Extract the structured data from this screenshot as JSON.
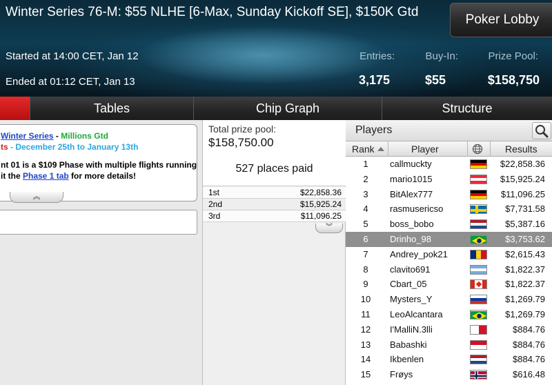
{
  "header": {
    "title": "Winter Series 76-M: $55 NLHE [6-Max, Sunday Kickoff SE], $150K Gtd",
    "lobby_button": "Poker Lobby",
    "started": "Started at 14:00 CET, Jan 12",
    "ended": "Ended at 01:12 CET, Jan 13",
    "entries_label": "Entries:",
    "entries_value": "3,175",
    "buyin_label": "Buy-In:",
    "buyin_value": "$55",
    "prize_label": "Prize Pool:",
    "prize_value": "$158,750"
  },
  "tabs": [
    {
      "label": ""
    },
    {
      "label": "Tables"
    },
    {
      "label": "Chip Graph"
    },
    {
      "label": "Structure"
    }
  ],
  "promo": {
    "series_link": "Winter Series",
    "separator": " - ",
    "millions": "Millions Gtd",
    "prefix_red": "ts",
    "dates": " - December 25th to January 13th",
    "line3": "nt 01 is a $109 Phase with multiple flights running",
    "line4_pre": "it the ",
    "phase_link": "Phase 1 tab",
    "line4_post": " for more details!",
    "tab_glyph": "︽"
  },
  "prize_pool": {
    "label": "Total prize pool:",
    "value": "$158,750.00",
    "places": "527 places paid",
    "payouts": [
      {
        "place": "1st",
        "amount": "$22,858.36"
      },
      {
        "place": "2nd",
        "amount": "$15,925.24"
      },
      {
        "place": "3rd",
        "amount": "$11,096.25"
      }
    ],
    "tab_glyph": "︾"
  },
  "players": {
    "title": "Players",
    "col_rank": "Rank",
    "col_player": "Player",
    "col_results": "Results",
    "rows": [
      {
        "rank": "1",
        "name": "callmuckty",
        "flag": "de",
        "result": "$22,858.36"
      },
      {
        "rank": "2",
        "name": "mario1015",
        "flag": "at",
        "result": "$15,925.24"
      },
      {
        "rank": "3",
        "name": "BitAlex777",
        "flag": "de",
        "result": "$11,096.25"
      },
      {
        "rank": "4",
        "name": "rasmusericso",
        "flag": "se",
        "result": "$7,731.58"
      },
      {
        "rank": "5",
        "name": "boss_bobo",
        "flag": "nl",
        "result": "$5,387.16"
      },
      {
        "rank": "6",
        "name": "Drinho_98",
        "flag": "br",
        "result": "$3,753.62"
      },
      {
        "rank": "7",
        "name": "Andrey_pok21",
        "flag": "ro",
        "result": "$2,615.43"
      },
      {
        "rank": "8",
        "name": "clavito691",
        "flag": "ar",
        "result": "$1,822.37"
      },
      {
        "rank": "9",
        "name": "Cbart_05",
        "flag": "ca",
        "result": "$1,822.37"
      },
      {
        "rank": "10",
        "name": "Mysters_Y",
        "flag": "ru",
        "result": "$1,269.79"
      },
      {
        "rank": "11",
        "name": "LeoAlcantara",
        "flag": "br",
        "result": "$1,269.79"
      },
      {
        "rank": "12",
        "name": "I'MalliN.3lli",
        "flag": "mt",
        "result": "$884.76"
      },
      {
        "rank": "13",
        "name": "Babashki",
        "flag": "id",
        "result": "$884.76"
      },
      {
        "rank": "14",
        "name": "Ikbenlen",
        "flag": "nl",
        "result": "$884.76"
      },
      {
        "rank": "15",
        "name": "Frøys",
        "flag": "no",
        "result": "$616.48"
      }
    ],
    "selected_rank": "6"
  },
  "colors": {
    "active_tab": "#d61c1c",
    "link_blue": "#2045c8",
    "promo_green": "#1ea83c",
    "promo_red": "#d01f1f",
    "promo_cyan": "#2aa6e0",
    "selected_row": "#8f8f8f"
  }
}
